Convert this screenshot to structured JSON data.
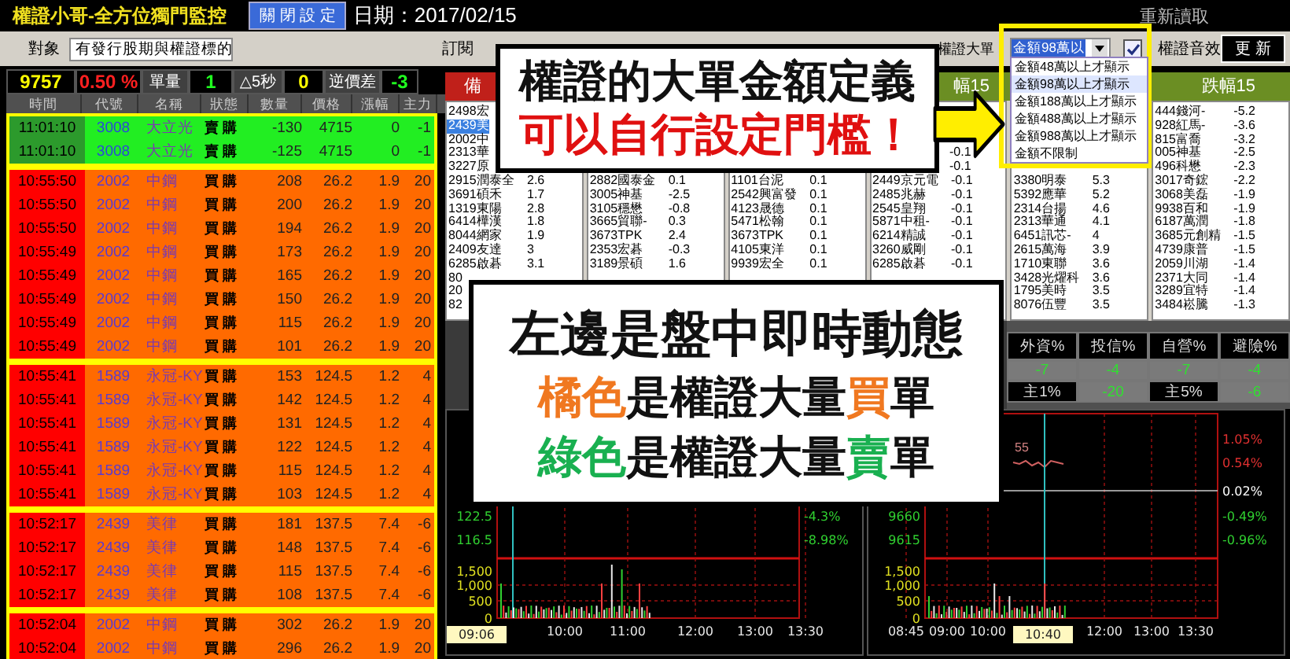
{
  "title_bar": {
    "app_title": "權證小哥-全方位獨門監控",
    "close_settings_button": "關 閉 設 定",
    "date": "日期：2017/02/15",
    "reload": "重新讀取"
  },
  "toolbar": {
    "target_label": "對象",
    "target_select": "有發行股期與權證標的",
    "subscribe_label": "訂閱",
    "big_order_label": "權證大單",
    "sound_checkbox": {
      "label": "權證音效",
      "checked": true
    },
    "update_button": "更 新"
  },
  "amount_dropdown": {
    "value": "金額98萬以",
    "options": [
      {
        "label": "金額48萬以上才顯示",
        "selected": false
      },
      {
        "label": "金額98萬以上才顯示",
        "selected": true
      },
      {
        "label": "金額188萬以上才顯示",
        "selected": false
      },
      {
        "label": "金額488萬以上才顯示",
        "selected": false
      },
      {
        "label": "金額988萬以上才顯示",
        "selected": false
      },
      {
        "label": "金額不限制",
        "selected": false
      }
    ]
  },
  "stats_bar": [
    {
      "text": "9757",
      "kind": "index"
    },
    {
      "text": "0.50 %",
      "kind": "change"
    },
    {
      "text": "單量",
      "kind": "label"
    },
    {
      "text": "1",
      "kind": "volume"
    },
    {
      "text": "△5秒",
      "kind": "label"
    },
    {
      "text": "0",
      "kind": "tick"
    },
    {
      "text": "逆價差",
      "kind": "label"
    },
    {
      "text": "-3",
      "kind": "spread"
    }
  ],
  "left_table": {
    "columns": [
      "時間",
      "代號",
      "名稱",
      "狀態",
      "數量",
      "價格",
      "漲幅",
      "主力"
    ],
    "groups": [
      {
        "rows": [
          {
            "time": "11:01:10",
            "code": "3008",
            "name": "大立光",
            "side": "賣 購",
            "volume": "-130",
            "price": "4715",
            "change": "0",
            "main": "-1",
            "kind": "sell"
          },
          {
            "time": "11:01:10",
            "code": "3008",
            "name": "大立光",
            "side": "賣 購",
            "volume": "-125",
            "price": "4715",
            "change": "0",
            "main": "-1",
            "kind": "sell"
          }
        ]
      },
      {
        "rows": [
          {
            "time": "10:55:50",
            "code": "2002",
            "name": "中鋼",
            "side": "買 購",
            "volume": "208",
            "price": "26.2",
            "change": "1.9",
            "main": "20",
            "kind": "buy"
          },
          {
            "time": "10:55:50",
            "code": "2002",
            "name": "中鋼",
            "side": "買 購",
            "volume": "200",
            "price": "26.2",
            "change": "1.9",
            "main": "20",
            "kind": "buy"
          },
          {
            "time": "10:55:50",
            "code": "2002",
            "name": "中鋼",
            "side": "買 購",
            "volume": "194",
            "price": "26.2",
            "change": "1.9",
            "main": "20",
            "kind": "buy"
          },
          {
            "time": "10:55:49",
            "code": "2002",
            "name": "中鋼",
            "side": "買 購",
            "volume": "173",
            "price": "26.2",
            "change": "1.9",
            "main": "20",
            "kind": "buy"
          },
          {
            "time": "10:55:49",
            "code": "2002",
            "name": "中鋼",
            "side": "買 購",
            "volume": "165",
            "price": "26.2",
            "change": "1.9",
            "main": "20",
            "kind": "buy"
          },
          {
            "time": "10:55:49",
            "code": "2002",
            "name": "中鋼",
            "side": "買 購",
            "volume": "150",
            "price": "26.2",
            "change": "1.9",
            "main": "20",
            "kind": "buy"
          },
          {
            "time": "10:55:49",
            "code": "2002",
            "name": "中鋼",
            "side": "買 購",
            "volume": "115",
            "price": "26.2",
            "change": "1.9",
            "main": "20",
            "kind": "buy"
          },
          {
            "time": "10:55:49",
            "code": "2002",
            "name": "中鋼",
            "side": "買 購",
            "volume": "101",
            "price": "26.2",
            "change": "1.9",
            "main": "20",
            "kind": "buy"
          }
        ]
      },
      {
        "rows": [
          {
            "time": "10:55:41",
            "code": "1589",
            "name": "永冠-KY",
            "side": "買 購",
            "volume": "153",
            "price": "124.5",
            "change": "1.2",
            "main": "4",
            "kind": "buy"
          },
          {
            "time": "10:55:41",
            "code": "1589",
            "name": "永冠-KY",
            "side": "買 購",
            "volume": "142",
            "price": "124.5",
            "change": "1.2",
            "main": "4",
            "kind": "buy"
          },
          {
            "time": "10:55:41",
            "code": "1589",
            "name": "永冠-KY",
            "side": "買 購",
            "volume": "131",
            "price": "124.5",
            "change": "1.2",
            "main": "4",
            "kind": "buy"
          },
          {
            "time": "10:55:41",
            "code": "1589",
            "name": "永冠-KY",
            "side": "買 購",
            "volume": "122",
            "price": "124.5",
            "change": "1.2",
            "main": "4",
            "kind": "buy"
          },
          {
            "time": "10:55:41",
            "code": "1589",
            "name": "永冠-KY",
            "side": "買 購",
            "volume": "115",
            "price": "124.5",
            "change": "1.2",
            "main": "4",
            "kind": "buy"
          },
          {
            "time": "10:55:41",
            "code": "1589",
            "name": "永冠-KY",
            "side": "買 購",
            "volume": "103",
            "price": "124.5",
            "change": "1.2",
            "main": "4",
            "kind": "buy"
          }
        ]
      },
      {
        "rows": [
          {
            "time": "10:52:17",
            "code": "2439",
            "name": "美律",
            "side": "買 購",
            "volume": "181",
            "price": "137.5",
            "change": "7.4",
            "main": "-6",
            "kind": "buy"
          },
          {
            "time": "10:52:17",
            "code": "2439",
            "name": "美律",
            "side": "買 購",
            "volume": "148",
            "price": "137.5",
            "change": "7.4",
            "main": "-6",
            "kind": "buy"
          },
          {
            "time": "10:52:17",
            "code": "2439",
            "name": "美律",
            "side": "買 購",
            "volume": "115",
            "price": "137.5",
            "change": "7.4",
            "main": "-6",
            "kind": "buy"
          },
          {
            "time": "10:52:17",
            "code": "2439",
            "name": "美律",
            "side": "買 購",
            "volume": "108",
            "price": "137.5",
            "change": "7.4",
            "main": "-6",
            "kind": "buy"
          }
        ]
      },
      {
        "rows": [
          {
            "time": "10:52:04",
            "code": "2002",
            "name": "中鋼",
            "side": "買 購",
            "volume": "302",
            "price": "26.2",
            "change": "1.9",
            "main": "20",
            "kind": "buy"
          },
          {
            "time": "10:52:04",
            "code": "2002",
            "name": "中鋼",
            "side": "買 購",
            "volume": "296",
            "price": "26.2",
            "change": "1.9",
            "main": "20",
            "kind": "buy"
          }
        ]
      }
    ]
  },
  "list_headers": [
    {
      "text": "備",
      "color": "#c0201a"
    },
    {
      "text": "幅15",
      "color": "#6b8e23"
    },
    {
      "text": "跌幅15",
      "color": "#6b8e23"
    }
  ],
  "lists": [
    {
      "items": [
        {
          "text": "2498宏",
          "selected": false
        },
        {
          "text": "2439美",
          "selected": true
        },
        {
          "text": "2002中",
          "selected": false
        },
        {
          "text": "2313華",
          "selected": false
        },
        {
          "text": "3227原",
          "selected": false
        },
        {
          "text": "2915潤泰全",
          "value": "2.6",
          "selected": false
        },
        {
          "text": "3691碩禾",
          "value": "1.7",
          "selected": false
        },
        {
          "text": "1319東陽",
          "value": "2.8",
          "selected": false
        },
        {
          "text": "6414樺漢",
          "value": "1.8",
          "selected": false
        },
        {
          "text": "8044網家",
          "value": "1.9",
          "selected": false
        },
        {
          "text": "2409友達",
          "value": "3",
          "selected": false
        },
        {
          "text": "6285啟碁",
          "value": "3.1",
          "selected": false
        },
        {
          "text": "80",
          "selected": false
        },
        {
          "text": "20",
          "selected": false
        },
        {
          "text": "82",
          "selected": false
        }
      ]
    },
    {
      "items": [
        {
          "text": "2882國泰金",
          "value": "0.1",
          "selected": false
        },
        {
          "text": "3005神基",
          "value": "-2.5",
          "selected": false
        },
        {
          "text": "3105穩懋",
          "value": "-0.8",
          "selected": false
        },
        {
          "text": "3665貿聯-",
          "value": "0.3",
          "selected": false
        },
        {
          "text": "3673TPK",
          "value": "2.4",
          "selected": false
        },
        {
          "text": "2353宏碁",
          "value": "-0.3",
          "selected": false
        },
        {
          "text": "3189景碩",
          "value": "1.6",
          "selected": false
        }
      ]
    },
    {
      "items": [
        {
          "text": "1101台泥",
          "value": "0.1",
          "selected": false
        },
        {
          "text": "2542興富發",
          "value": "0.1",
          "selected": false
        },
        {
          "text": "4123晟德",
          "value": "0.1",
          "selected": false
        },
        {
          "text": "5471松翰",
          "value": "0.1",
          "selected": false
        },
        {
          "text": "3673TPK",
          "value": "0.1",
          "selected": false
        },
        {
          "text": "4105東洋",
          "value": "0.1",
          "selected": false
        },
        {
          "text": "9939宏全",
          "value": "0.1",
          "selected": false
        }
      ]
    },
    {
      "items": [
        {
          "value": "-0.1",
          "selected": false
        },
        {
          "value": "-0.1",
          "selected": false
        },
        {
          "text": "2449京元電",
          "value": "-0.1",
          "selected": false
        },
        {
          "text": "2485兆赫",
          "value": "-0.1",
          "selected": false
        },
        {
          "text": "2545皇翔",
          "value": "-0.1",
          "selected": false
        },
        {
          "text": "5871中租-",
          "value": "-0.1",
          "selected": false
        },
        {
          "text": "6214精誠",
          "value": "-0.1",
          "selected": false
        },
        {
          "text": "3260威剛",
          "value": "-0.1",
          "selected": false
        },
        {
          "text": "6285啟碁",
          "value": "-0.1",
          "selected": false
        }
      ]
    },
    {
      "items": [
        {
          "text": "3380明泰",
          "value": "5.3",
          "selected": false
        },
        {
          "text": "5392應華",
          "value": "5.2",
          "selected": false
        },
        {
          "text": "2314台揚",
          "value": "4.6",
          "selected": false
        },
        {
          "text": "2313華通",
          "value": "4.1",
          "selected": false
        },
        {
          "text": "6451訊芯-",
          "value": "4",
          "selected": false
        },
        {
          "text": "2615萬海",
          "value": "3.9",
          "selected": false
        },
        {
          "text": "1710東聯",
          "value": "3.6",
          "selected": false
        },
        {
          "text": "3428光燿科",
          "value": "3.6",
          "selected": false
        },
        {
          "text": "1795美時",
          "value": "3.5",
          "selected": false
        },
        {
          "text": "8076伍豐",
          "value": "3.5",
          "selected": false
        }
      ]
    },
    {
      "items": [
        {
          "text": "444錢河-",
          "value": "-5.2",
          "selected": false
        },
        {
          "text": "928紅馬-",
          "value": "-3.6",
          "selected": false
        },
        {
          "text": "815富喬",
          "value": "-3.2",
          "selected": false
        },
        {
          "text": "005神基",
          "value": "-2.5",
          "selected": false
        },
        {
          "text": "496科懋",
          "value": "-2.3",
          "selected": false
        },
        {
          "text": "3017奇鋐",
          "value": "-2.2",
          "selected": false
        },
        {
          "text": "3068美磊",
          "value": "-1.9",
          "selected": false
        },
        {
          "text": "9938百和",
          "value": "-1.9",
          "selected": false
        },
        {
          "text": "6187萬潤",
          "value": "-1.8",
          "selected": false
        },
        {
          "text": "3685元創精",
          "value": "-1.5",
          "selected": false
        },
        {
          "text": "4739康普",
          "value": "-1.5",
          "selected": false
        },
        {
          "text": "2059川湖",
          "value": "-1.4",
          "selected": false
        },
        {
          "text": "2371大同",
          "value": "-1.4",
          "selected": false
        },
        {
          "text": "3289宜特",
          "value": "-1.4",
          "selected": false
        },
        {
          "text": "3484崧騰",
          "value": "-1.3",
          "selected": false
        }
      ]
    }
  ],
  "institutional": {
    "headers": [
      "外資%",
      "投信%",
      "自營%",
      "避險%"
    ],
    "rows": [
      [
        {
          "text": "-7",
          "kind": "value"
        },
        {
          "text": "-4",
          "kind": "value"
        },
        {
          "text": "-7",
          "kind": "value"
        },
        {
          "text": "-4",
          "kind": "value"
        }
      ],
      [
        {
          "text": "主1%",
          "kind": "label"
        },
        {
          "text": "-20",
          "kind": "value"
        },
        {
          "text": "主5%",
          "kind": "label"
        },
        {
          "text": "-6",
          "kind": "value"
        }
      ]
    ]
  },
  "charts": [
    {
      "price_labels": [
        "122.5",
        "116.5"
      ],
      "pct_labels": [
        {
          "text": "-4.3%",
          "color": "#30d030"
        },
        {
          "text": "-8.98%",
          "color": "#30d030"
        }
      ],
      "volume_labels": [
        "1,500",
        "1,000",
        "500",
        "0"
      ],
      "time_labels": [
        "10:00",
        "11:00",
        "12:00",
        "13:00",
        "13:30"
      ],
      "cursor_time": "09:06"
    },
    {
      "note": "55",
      "price_labels": [
        "9660",
        "9615"
      ],
      "pct_labels": [
        {
          "text": "1.05%",
          "color": "#e03030"
        },
        {
          "text": "0.54%",
          "color": "#e03030"
        },
        {
          "text": "0.02%",
          "color": "#ffffff"
        },
        {
          "text": "-0.49%",
          "color": "#30d030"
        },
        {
          "text": "-0.96%",
          "color": "#30d030"
        }
      ],
      "volume_labels": [
        "1,500",
        "1,000",
        "500",
        "0"
      ],
      "time_labels": [
        "08:45",
        "09:00",
        "10:00",
        "12:00",
        "13:00",
        "13:30"
      ],
      "cursor_time": "10:40"
    }
  ],
  "callout_top": {
    "line_1": "權證的大單金額定義",
    "line_2": "可以自行設定門檻！"
  },
  "callout_main": {
    "line_1": "左邊是盤中即時動態",
    "line_2": [
      {
        "text": "橘色",
        "color": "#f07820"
      },
      {
        "text": "是權證大量",
        "color": "#111111"
      },
      {
        "text": "買",
        "color": "#f07820"
      },
      {
        "text": "單",
        "color": "#111111"
      }
    ],
    "line_3": [
      {
        "text": "綠色",
        "color": "#19b050"
      },
      {
        "text": "是權證大量",
        "color": "#111111"
      },
      {
        "text": "賣",
        "color": "#19b050"
      },
      {
        "text": "單",
        "color": "#111111"
      }
    ]
  }
}
